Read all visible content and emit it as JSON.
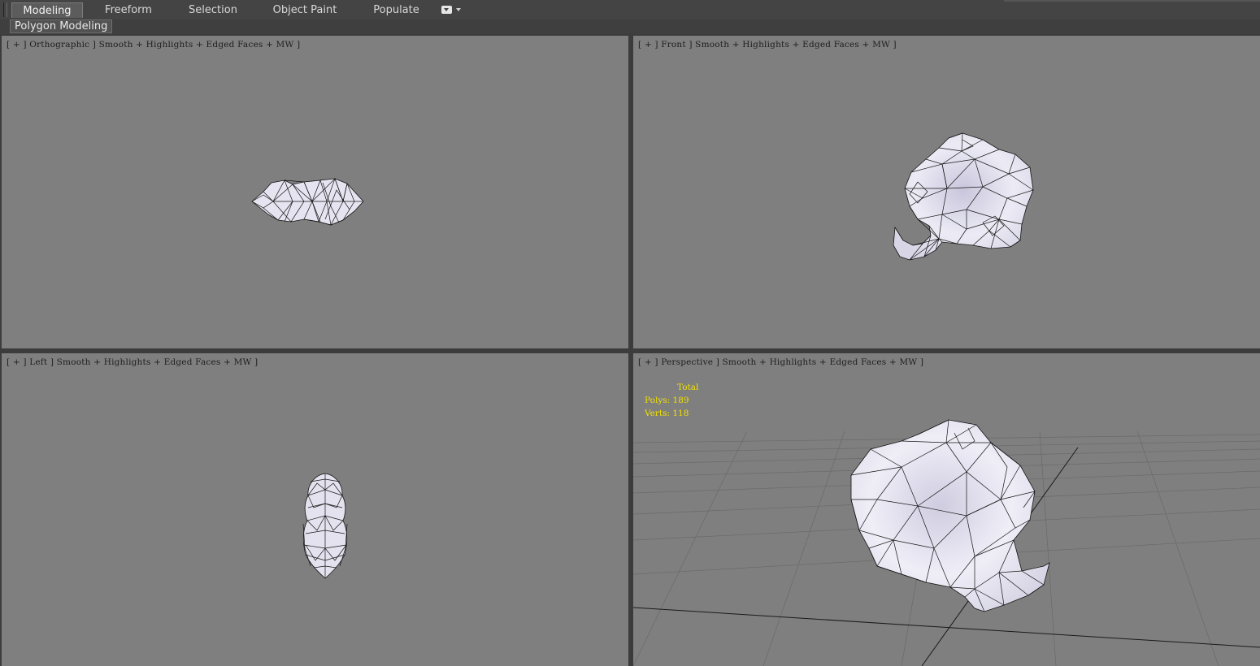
{
  "ribbon": {
    "tabs": [
      {
        "label": "Modeling",
        "active": true
      },
      {
        "label": "Freeform",
        "active": false
      },
      {
        "label": "Selection",
        "active": false
      },
      {
        "label": "Object Paint",
        "active": false
      },
      {
        "label": "Populate",
        "active": false
      }
    ],
    "panel_label": "Polygon Modeling"
  },
  "viewports": {
    "top_left": {
      "label": "[ + ] Orthographic ] Smooth + Highlights + Edged Faces + MW ]"
    },
    "top_right": {
      "label": "[ + ] Front ] Smooth + Highlights + Edged Faces + MW ]"
    },
    "bottom_left": {
      "label": "[ + ] Left ] Smooth + Highlights + Edged Faces + MW ]"
    },
    "bottom_right": {
      "label": "[ + ] Perspective ] Smooth + Highlights + Edged Faces + MW ]",
      "stats": {
        "title": "Total",
        "polys_label": "Polys:",
        "polys_value": "189",
        "verts_label": "Verts:",
        "verts_value": "118"
      }
    }
  },
  "colors": {
    "viewport_bg": "#7f7f7f",
    "ui_bg": "#3c3c3c",
    "stats_text": "#f0e000",
    "mesh_fill": "#e8e6f2"
  },
  "icons": {
    "tab_dropdown": "dropdown-icon"
  }
}
